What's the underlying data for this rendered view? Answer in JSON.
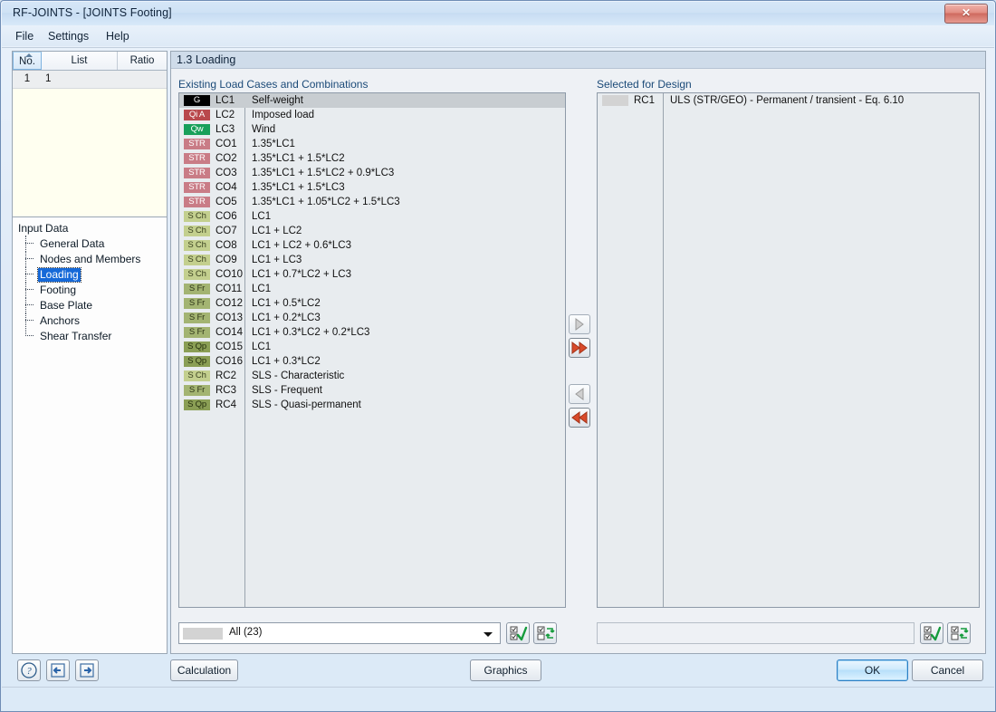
{
  "window": {
    "title": "RF-JOINTS - [JOINTS Footing]",
    "close_label": "✕"
  },
  "menu": {
    "items": [
      {
        "label": "File"
      },
      {
        "label": "Settings"
      },
      {
        "label": "Help"
      }
    ]
  },
  "left_table": {
    "headers": [
      "No.",
      "List",
      "Ratio"
    ],
    "rows": [
      {
        "no": "1",
        "list": "1",
        "ratio": ""
      }
    ]
  },
  "tree": {
    "root": "Input Data",
    "items": [
      {
        "label": "General Data",
        "selected": false
      },
      {
        "label": "Nodes and Members",
        "selected": false
      },
      {
        "label": "Loading",
        "selected": true
      },
      {
        "label": "Footing",
        "selected": false
      },
      {
        "label": "Base Plate",
        "selected": false
      },
      {
        "label": "Anchors",
        "selected": false
      },
      {
        "label": "Shear Transfer",
        "selected": false
      }
    ]
  },
  "panel": {
    "header": "1.3 Loading",
    "left_group_title": "Existing Load Cases and Combinations",
    "right_group_title": "Selected for Design"
  },
  "existing": {
    "rows": [
      {
        "badge": "G",
        "style": "b-G",
        "code": "LC1",
        "desc": "Self-weight",
        "selected": true
      },
      {
        "badge": "Qi A",
        "style": "b-QiA",
        "code": "LC2",
        "desc": "Imposed load",
        "selected": false
      },
      {
        "badge": "Qw",
        "style": "b-Qw",
        "code": "LC3",
        "desc": "Wind",
        "selected": false
      },
      {
        "badge": "STR",
        "style": "b-STR",
        "code": "CO1",
        "desc": "1.35*LC1",
        "selected": false
      },
      {
        "badge": "STR",
        "style": "b-STR",
        "code": "CO2",
        "desc": "1.35*LC1 + 1.5*LC2",
        "selected": false
      },
      {
        "badge": "STR",
        "style": "b-STR",
        "code": "CO3",
        "desc": "1.35*LC1 + 1.5*LC2 + 0.9*LC3",
        "selected": false
      },
      {
        "badge": "STR",
        "style": "b-STR",
        "code": "CO4",
        "desc": "1.35*LC1 + 1.5*LC3",
        "selected": false
      },
      {
        "badge": "STR",
        "style": "b-STR",
        "code": "CO5",
        "desc": "1.35*LC1 + 1.05*LC2 + 1.5*LC3",
        "selected": false
      },
      {
        "badge": "S Ch",
        "style": "b-SCh",
        "code": "CO6",
        "desc": "LC1",
        "selected": false
      },
      {
        "badge": "S Ch",
        "style": "b-SCh",
        "code": "CO7",
        "desc": "LC1 + LC2",
        "selected": false
      },
      {
        "badge": "S Ch",
        "style": "b-SCh",
        "code": "CO8",
        "desc": "LC1 + LC2 + 0.6*LC3",
        "selected": false
      },
      {
        "badge": "S Ch",
        "style": "b-SCh",
        "code": "CO9",
        "desc": "LC1 + LC3",
        "selected": false
      },
      {
        "badge": "S Ch",
        "style": "b-SCh",
        "code": "CO10",
        "desc": "LC1 + 0.7*LC2 + LC3",
        "selected": false
      },
      {
        "badge": "S Fr",
        "style": "b-SFr",
        "code": "CO11",
        "desc": "LC1",
        "selected": false
      },
      {
        "badge": "S Fr",
        "style": "b-SFr",
        "code": "CO12",
        "desc": "LC1 + 0.5*LC2",
        "selected": false
      },
      {
        "badge": "S Fr",
        "style": "b-SFr",
        "code": "CO13",
        "desc": "LC1 + 0.2*LC3",
        "selected": false
      },
      {
        "badge": "S Fr",
        "style": "b-SFr",
        "code": "CO14",
        "desc": "LC1 + 0.3*LC2 + 0.2*LC3",
        "selected": false
      },
      {
        "badge": "S Qp",
        "style": "b-SQp",
        "code": "CO15",
        "desc": "LC1",
        "selected": false
      },
      {
        "badge": "S Qp",
        "style": "b-SQp",
        "code": "CO16",
        "desc": "LC1 + 0.3*LC2",
        "selected": false
      },
      {
        "badge": "S Ch",
        "style": "b-SCh",
        "code": "RC2",
        "desc": "SLS - Characteristic",
        "selected": false
      },
      {
        "badge": "S Fr",
        "style": "b-SFr",
        "code": "RC3",
        "desc": "SLS - Frequent",
        "selected": false
      },
      {
        "badge": "S Qp",
        "style": "b-SQp",
        "code": "RC4",
        "desc": "SLS - Quasi-permanent",
        "selected": false
      }
    ],
    "filter": {
      "value": "All (23)",
      "select_all_icon": "check-all-icon",
      "invert_icon": "invert-selection-icon"
    }
  },
  "selected_for_design": {
    "rows": [
      {
        "badge": "",
        "style": "b-none",
        "code": "RC1",
        "desc": "ULS (STR/GEO) - Permanent / transient - Eq. 6.10",
        "selected": false
      }
    ],
    "select_all_icon": "check-all-icon",
    "invert_icon": "invert-selection-icon"
  },
  "transfer": {
    "to_right": "▶",
    "all_to_right": "»",
    "to_left": "◀",
    "all_to_left": "«"
  },
  "bottom": {
    "help_icon": "help-icon",
    "prev_icon": "previous-icon",
    "next_icon": "next-icon",
    "calculation": "Calculation",
    "graphics": "Graphics",
    "ok": "OK",
    "cancel": "Cancel"
  }
}
